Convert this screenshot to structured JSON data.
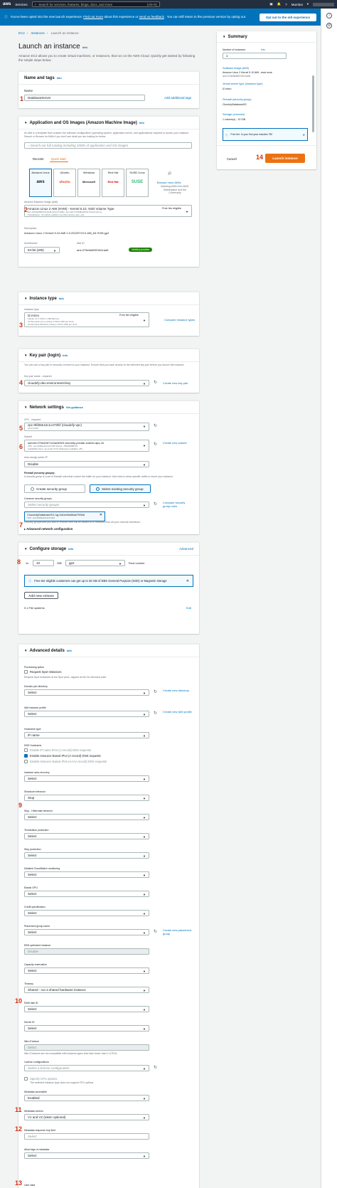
{
  "nav": {
    "services": "Services",
    "search_placeholder": "Search for services, features, blogs, docs, and more",
    "shortcut": "[Alt+S]",
    "region": "Mumbai"
  },
  "banner": {
    "text1": "You've been opted into the new launch experience.",
    "link1": "Find out more",
    "text2": "about this experience or",
    "link2": "send us feedback",
    "text3": ". You can still return to the previous version by opting out.",
    "opt_out": "Opt out to the old experience"
  },
  "breadcrumb": {
    "ec2": "EC2",
    "instances": "Instances",
    "current": "Launch an instance"
  },
  "page": {
    "title": "Launch an instance",
    "info": "Info",
    "description": "Amazon EC2 allows you to create virtual machines, or instances, that run on the AWS Cloud. Quickly get started by following the simple steps below."
  },
  "name_tags": {
    "title": "Name and tags",
    "info": "Info",
    "name_label": "Name",
    "name_value": "DatabaseServer",
    "add_tags": "Add additional tags"
  },
  "ami": {
    "title": "Application and OS Images (Amazon Machine Image)",
    "info": "Info",
    "description": "An AMI is a template that contains the software configuration (operating system, application server, and applications) required to launch your instance. Search or Browse for AMIs if you don't see what you are looking for below",
    "search_placeholder": "Search our full catalog including 1000s of application and OS images",
    "tab_recents": "Recents",
    "tab_quick": "Quick Start",
    "tiles": [
      {
        "name": "Amazon Linux",
        "logo": "aws"
      },
      {
        "name": "Ubuntu",
        "logo": "ubuntu"
      },
      {
        "name": "Windows",
        "logo": "Microsoft"
      },
      {
        "name": "Red Hat",
        "logo": "Red Hat"
      },
      {
        "name": "SUSE Linux",
        "logo": "SUSE"
      }
    ],
    "browse": "Browse more AMIs",
    "browse_sub": "Including AMIs from AWS, Marketplace and the Community",
    "ami_label": "Amazon Machine Image (AMI)",
    "ami_value": "Amazon Linux 2 AMI (HVM) - Kernel 5.10, SSD Volume Type",
    "ami_sub": "ami-076e5a5557efe1ad6 (64-bit (x86)) / ami-0ac7173b9bd4f7a4 (64-bit (Arm))",
    "ami_sub2": "Virtualization: hvm    ENA enabled: true    Root device type: ebs",
    "free_tier": "Free tier eligible",
    "desc_label": "Description",
    "desc_value": "Amazon Linux 2 Kernel 5.10 AMI 2.0.20220719.0 x86_64 HVM gp2",
    "arch_label": "Architecture",
    "arch_value": "64-bit (x86)",
    "amiid_label": "AMI ID",
    "amiid_value": "ami-076e5a5557efe1ad6",
    "verified": "Verified provider"
  },
  "instance_type": {
    "title": "Instance type",
    "info": "Info",
    "label": "Instance type",
    "value": "t2.micro",
    "free_tier": "Free tier eligible",
    "sub1": "Family: t2    1 vCPU    1 GiB Memory",
    "sub2": "On-Demand Linux pricing: 0.0124 USD per Hour",
    "sub3": "On-Demand Windows pricing: 0.0172 USD per Hour",
    "compare": "Compare instance types"
  },
  "key_pair": {
    "title": "Key pair (login)",
    "info": "Info",
    "description": "You can use a key pair to securely connect to your instance. Ensure that you have access to the selected key pair before you launch the instance.",
    "label": "Key pair name - required",
    "value": "cloudofy-dev-environment-key",
    "create": "Create new key pair"
  },
  "network": {
    "title": "Network settings",
    "info": "Get guidance",
    "vpc_label": "VPC - required",
    "vpc_value": "vpc-0bf26e12c1c473fcf (cloudofy-vpc)",
    "vpc_sub": "10.0.0.0/16",
    "subnet_label": "Subnet",
    "subnet_value": "subnet-070ea0b71e0ac59e5        cloudofy-private-subnet-aps-1b",
    "subnet_sub1": "VPC: vpc-0bf26e12c1c473fcf    Owner: 765020868701",
    "subnet_sub2": "Availability Zone: ap-south-1b    IP addresses available: 251",
    "create_subnet": "Create new subnet",
    "public_ip_label": "Auto-assign public IP",
    "public_ip_value": "Disable",
    "firewall_label": "Firewall (security groups)",
    "firewall_desc": "A security group is a set of firewall rules that control the traffic for your instance. Add rules to allow specific traffic to reach your instance.",
    "create_sg": "Create security group",
    "select_sg": "Select existing security group",
    "common_sg_label": "Common security groups",
    "common_sg_placeholder": "Select security groups",
    "compare_sg": "Compare security group rules",
    "sg_tag": "CloudofyDatabaseSG   sg-0d1ed5d46ab7936d",
    "sg_tag_sub": "VPC: vpc-0bf26e12c1c473fcf",
    "sg_note": "Security groups that you add or remove here will be added to or removed from all your network interfaces.",
    "advanced": "Advanced network configuration"
  },
  "storage": {
    "title": "Configure storage",
    "info": "Info",
    "advanced": "Advanced",
    "qty": "1x",
    "size": "10",
    "unit": "GiB",
    "type": "gp2",
    "root": "Root volume",
    "notice": "Free tier eligible customers can get up to 30 GB of EBS General Purpose (SSD) or Magnetic storage",
    "add_volume": "Add new volume",
    "file_systems": "0 x File systems",
    "edit": "Edit"
  },
  "advanced": {
    "title": "Advanced details",
    "info": "Info",
    "purchasing_label": "Purchasing option",
    "spot": "Request Spot Instances",
    "spot_sub": "Request Spot Instances at the Spot price, capped at the On-Demand price",
    "domain_label": "Domain join directory",
    "create_dir": "Create new directory",
    "iam_label": "IAM instance profile",
    "create_iam": "Create new IAM profile",
    "hostname_label": "Hostname type",
    "hostname_value": "IP name",
    "dns_label": "DNS Hostname",
    "dns1": "Enable IP name IPv4 (A record) DNS requests",
    "dns2": "Enable resource-based IPv4 (A record) DNS requests",
    "dns3": "Enable resource-based IPv6 (AAAA record) DNS requests",
    "recovery_label": "Instance auto-recovery",
    "shutdown_label": "Shutdown behavior",
    "shutdown_value": "Stop",
    "hibernate_label": "Stop - Hibernate behavior",
    "termination_label": "Termination protection",
    "stop_label": "Stop protection",
    "cloudwatch_label": "Detailed CloudWatch monitoring",
    "gpu_label": "Elastic GPU",
    "credit_label": "Credit specification",
    "placement_label": "Placement group name",
    "create_placement": "Create new placement group",
    "ebs_label": "EBS-optimized instance",
    "ebs_value": "Disable",
    "capacity_label": "Capacity reservation",
    "tenancy_label": "Tenancy",
    "tenancy_value": "Shared - run a shared hardware instance",
    "ramdisk_label": "RAM disk ID",
    "kernel_label": "Kernel ID",
    "nitro_label": "Nitro Enclave",
    "nitro_sub": "Nitro Enclaves are not compatible with instance types that have fewer than 2 vCPUs",
    "license_label": "License configurations",
    "license_placeholder": "Select a license configuration",
    "cpu_opt": "Specify CPU options",
    "cpu_sub": "The selected instance type does not support CPU options",
    "meta_access_label": "Metadata accessible",
    "meta_access_value": "Enabled",
    "meta_version_label": "Metadata version",
    "meta_version_value": "V1 and V2 (token optional)",
    "hop_label": "Metadata response hop limit",
    "allow_tags_label": "Allow tags in metadata",
    "user_data_label": "User data",
    "select": "Select",
    "info_link": "Info"
  },
  "summary": {
    "title": "Summary",
    "count_label": "Number of instances",
    "count_value": "1",
    "image_label": "Software Image (AMI)",
    "image_value": "Amazon Linux 2 Kernel 5.10 AMI...read more",
    "image_sub": "ami-076e5a5557efe1ad6",
    "type_label": "Virtual server type (instance type)",
    "type_value": "t2.micro",
    "fw_label": "Firewall (security group)",
    "fw_value": "CloudofyDatabaseSG",
    "storage_label": "Storage (volumes)",
    "storage_value": "1 volume(s) - 10 GiB",
    "free_tier_note": "Free tier: In your first year includes 750",
    "cancel": "Cancel",
    "launch": "Launch instance"
  },
  "badges": [
    "1",
    "2",
    "3",
    "4",
    "5",
    "6",
    "7",
    "8",
    "9",
    "10",
    "11",
    "12",
    "13",
    "14"
  ]
}
